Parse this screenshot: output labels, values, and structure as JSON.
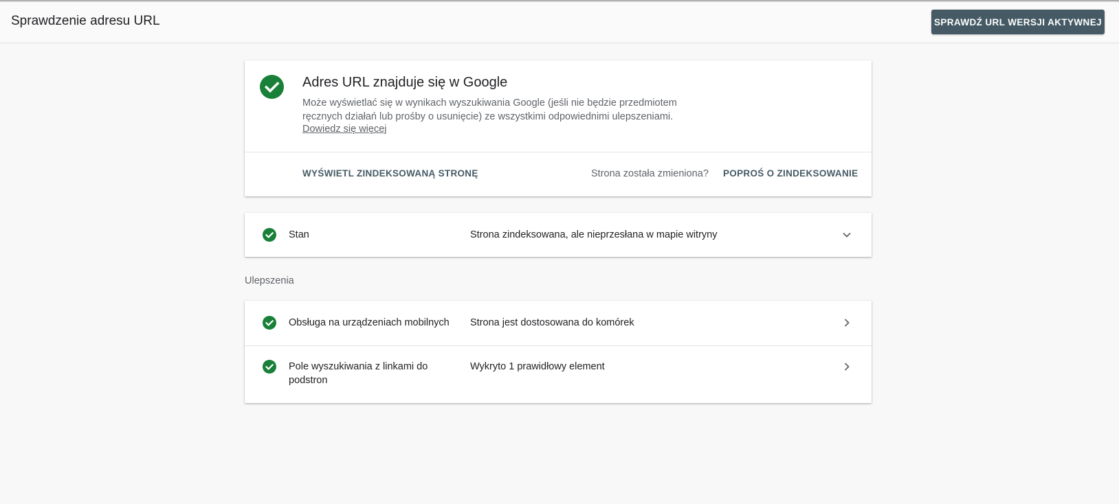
{
  "header": {
    "title": "Sprawdzenie adresu URL",
    "live_test_label": "SPRAWDŹ URL WERSJI AKTYWNEJ"
  },
  "summary": {
    "title": "Adres URL znajduje się w Google",
    "description": "Może wyświetlać się w wynikach wyszukiwania Google (jeśli nie będzie przedmiotem ręcznych działań lub prośby o usunięcie) ze wszystkimi odpowiednimi ulepszeniami.",
    "learn_more": "Dowiedz się więcej",
    "view_indexed_label": "WYŚWIETL ZINDEKSOWANĄ STRONĘ",
    "changed_question": "Strona została zmieniona?",
    "request_index_label": "POPROŚ O ZINDEKSOWANIE"
  },
  "status": {
    "label": "Stan",
    "value": "Strona zindeksowana, ale nieprzesłana w mapie witryny"
  },
  "enhancements": {
    "section_title": "Ulepszenia",
    "items": [
      {
        "label": "Obsługa na urządzeniach mobilnych",
        "value": "Strona jest dostosowana do komórek"
      },
      {
        "label": "Pole wyszukiwania z linkami do podstron",
        "value": "Wykryto 1 prawidłowy element"
      }
    ]
  },
  "colors": {
    "success_green": "#188038",
    "button_dark": "#455a64",
    "background": "#f8f8f8"
  },
  "icons": {
    "success": "check-circle-icon",
    "expand": "chevron-down-icon",
    "navigate": "chevron-right-icon"
  }
}
